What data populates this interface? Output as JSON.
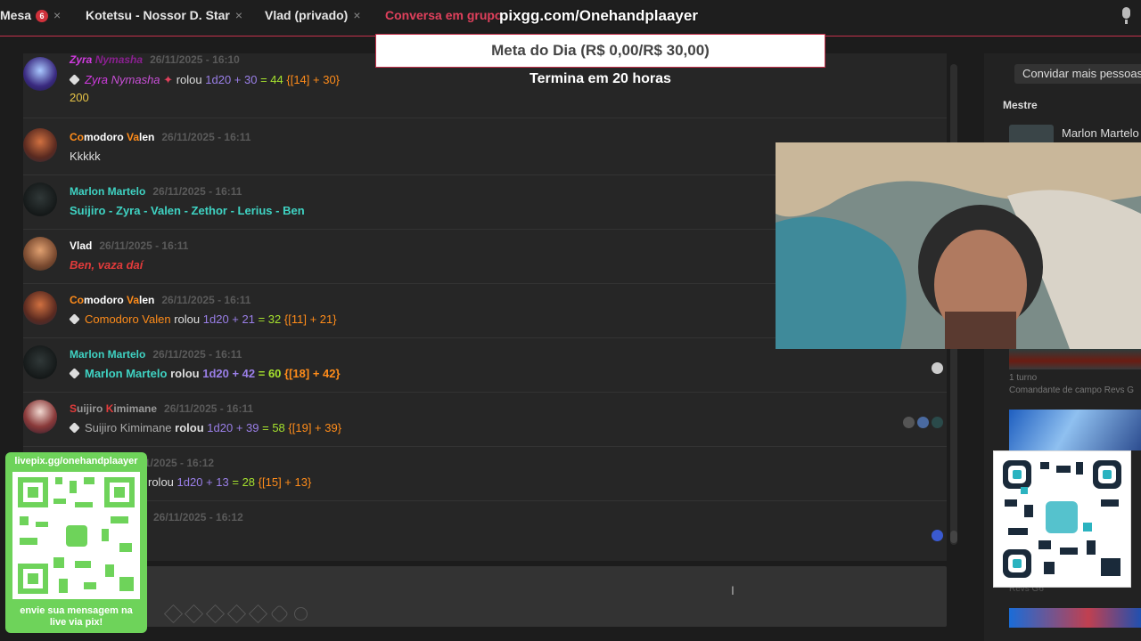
{
  "tabs": [
    {
      "label": "Mesa",
      "badge": "6",
      "close": "×"
    },
    {
      "label": "Kotetsu - Nossor D. Star",
      "close": "×"
    },
    {
      "label": "Vlad (privado)",
      "close": "×"
    },
    {
      "label": "Conversa em grupo",
      "close": ""
    }
  ],
  "overlay": {
    "url": "pixgg.com/Onehandplaayer",
    "meta": "Meta do Dia (R$ 0,00/R$ 30,00)",
    "termina": "Termina em 20 horas"
  },
  "messages": [
    {
      "name_a": "Zyra",
      "name_b": "Nymasha",
      "ts": "26/11/2025 - 16:10",
      "roll_name_a": "Zyra",
      "roll_name_b": "Nymasha",
      "verb": "rolou",
      "expr": "1d20 + 30",
      "eq": "= 44",
      "detail": "{[14] + 30}",
      "extra": "200"
    },
    {
      "name_a": "Co",
      "name_b": "modoro ",
      "name_c": "Va",
      "name_d": "len",
      "ts": "26/11/2025 - 16:11",
      "text": "Kkkkk"
    },
    {
      "name_a": "Marlon ",
      "name_b": "Martelo",
      "ts": "26/11/2025 - 16:11",
      "text": "Suijiro - Zyra - Valen - Zethor - Lerius - Ben"
    },
    {
      "name": "Vlad",
      "ts": "26/11/2025 - 16:11",
      "text": "Ben, vaza daí"
    },
    {
      "name_a": "Co",
      "name_b": "modoro ",
      "name_c": "Va",
      "name_d": "len",
      "ts": "26/11/2025 - 16:11",
      "roll_name": "Comodoro Valen",
      "verb": "rolou",
      "expr": "1d20 + 21",
      "eq": "= 32",
      "detail": "{[11] + 21}"
    },
    {
      "name_a": "Marlon ",
      "name_b": "Martelo",
      "ts": "26/11/2025 - 16:11",
      "roll_name": "Marlon Martelo",
      "verb": "rolou",
      "expr": "1d20 + 42",
      "eq": "= 60",
      "detail": "{[18] + 42}"
    },
    {
      "name_a": "S",
      "name_b": "uijiro ",
      "name_c": "K",
      "name_d": "imimane",
      "ts": "26/11/2025 - 16:11",
      "roll_name": "Suijiro Kimimane",
      "verb": "rolou",
      "expr": "1d20 + 39",
      "eq": "= 58",
      "detail": "{[19] + 39}"
    },
    {
      "ts": "11/2025 - 16:12",
      "verb": "rolou",
      "expr": "1d20 + 13",
      "eq": "= 28",
      "detail": "{[15] + 13}"
    },
    {
      "ts": "26/11/2025 - 16:12"
    }
  ],
  "right": {
    "invite": "Convidar mais pessoas",
    "mestre": "Mestre",
    "marlon": "Marlon Martelo",
    "turno": "1 turno",
    "cmd": "Comandante de campo Revs G",
    "revs": "Revs G6"
  },
  "livepix": {
    "url": "livepix.gg/onehandplaayer",
    "bottom1": "envie sua mensagem na",
    "bottom2": "live via pix!"
  },
  "colors": {
    "accent": "#e0405c",
    "roll": "#9a7fe8",
    "result": "#a6e22e",
    "kept": "#ff8c1a",
    "livepix": "#6ed35a"
  }
}
